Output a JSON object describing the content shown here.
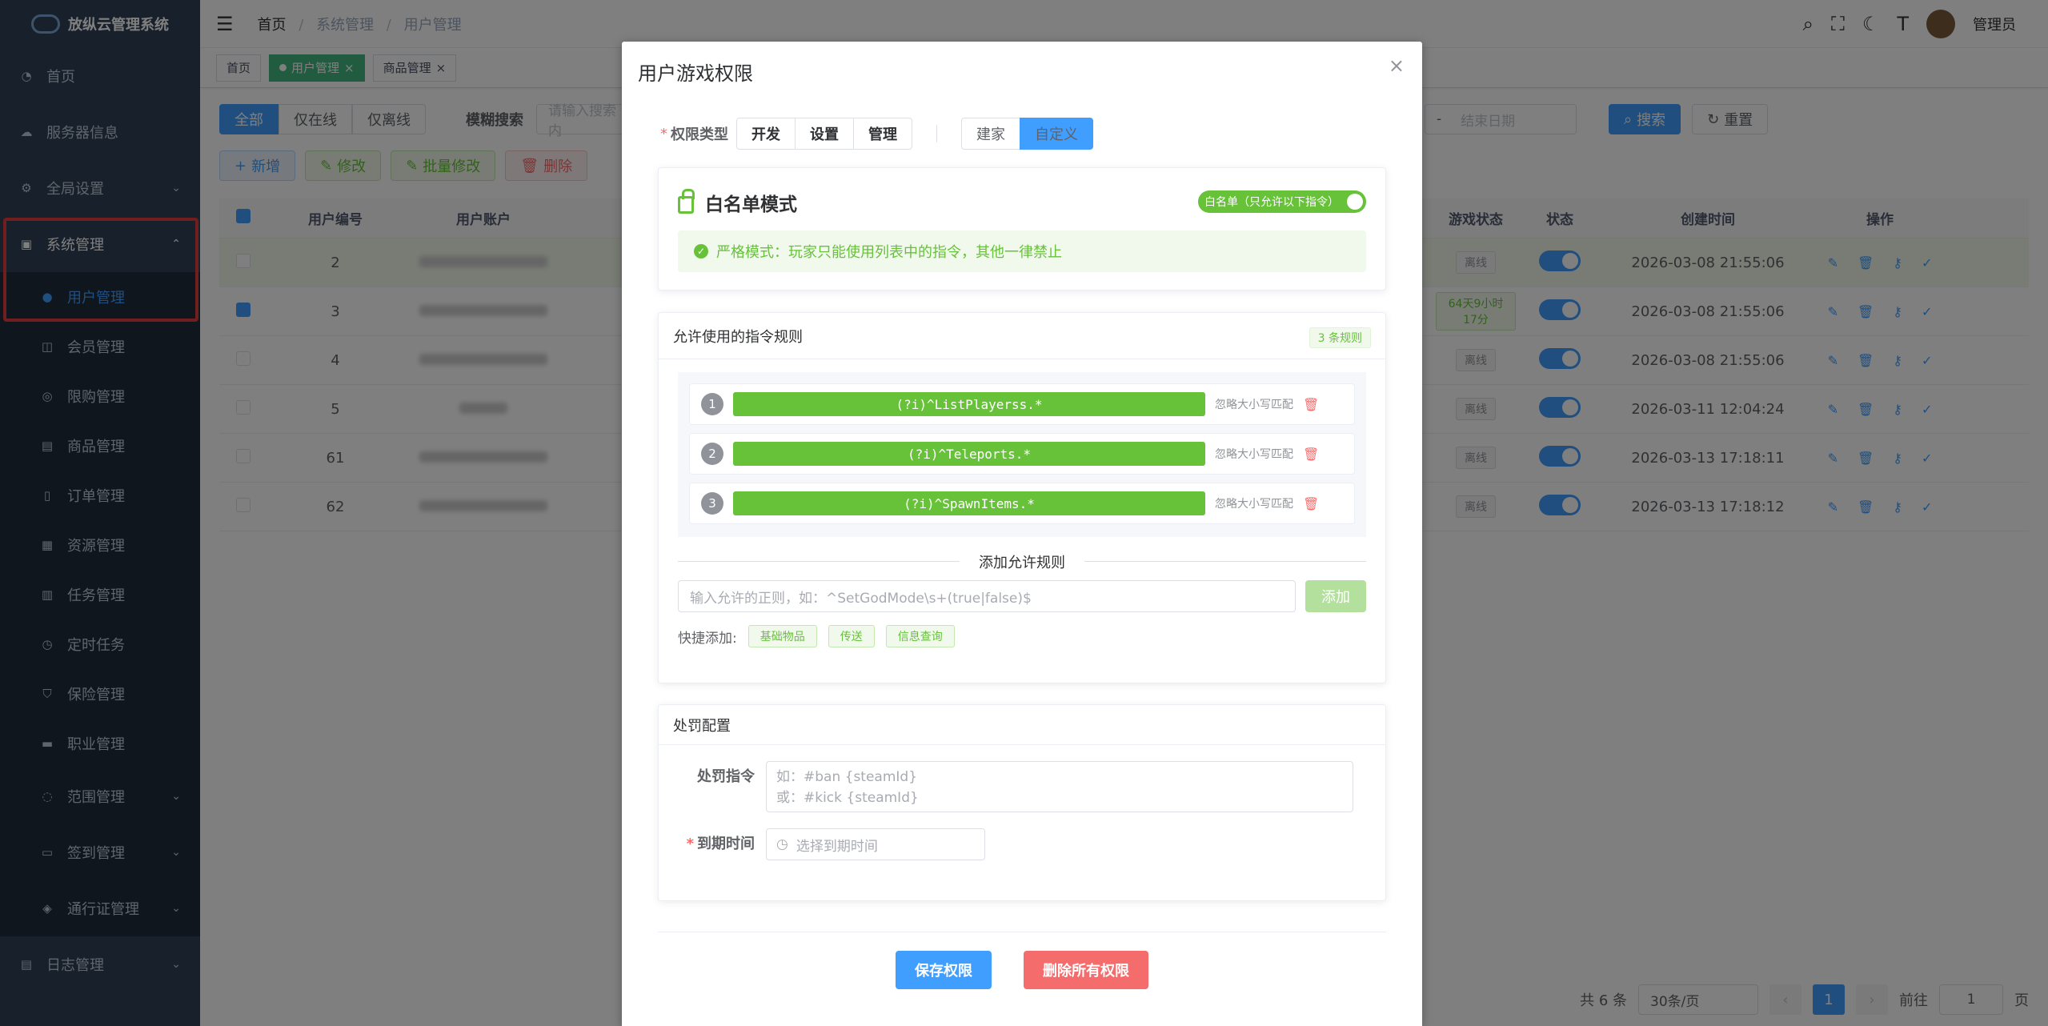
{
  "app": {
    "title": "放纵云管理系统"
  },
  "sidebar": {
    "items": [
      {
        "label": "首页",
        "icon": "dashboard-icon"
      },
      {
        "label": "服务器信息",
        "icon": "cloud-icon"
      },
      {
        "label": "全局设置",
        "icon": "gear-icon"
      },
      {
        "label": "系统管理",
        "icon": "monitor-icon"
      }
    ],
    "system_children": [
      {
        "label": "用户管理",
        "icon": "user-icon"
      },
      {
        "label": "会员管理",
        "icon": "vip-icon"
      },
      {
        "label": "限购管理",
        "icon": "limit-icon"
      },
      {
        "label": "商品管理",
        "icon": "cart-icon"
      },
      {
        "label": "订单管理",
        "icon": "order-icon"
      },
      {
        "label": "资源管理",
        "icon": "resource-icon"
      },
      {
        "label": "任务管理",
        "icon": "task-icon"
      },
      {
        "label": "定时任务",
        "icon": "clock-icon"
      },
      {
        "label": "保险管理",
        "icon": "shield-icon"
      },
      {
        "label": "职业管理",
        "icon": "briefcase-icon"
      },
      {
        "label": "范围管理",
        "icon": "range-icon"
      },
      {
        "label": "签到管理",
        "icon": "calendar-icon"
      },
      {
        "label": "通行证管理",
        "icon": "pass-icon"
      }
    ],
    "log": {
      "label": "日志管理",
      "icon": "log-icon"
    }
  },
  "header": {
    "breadcrumb": [
      "首页",
      "系统管理",
      "用户管理"
    ],
    "user": "管理员"
  },
  "tags": [
    "首页",
    "用户管理",
    "商品管理"
  ],
  "filters": {
    "online": [
      "全部",
      "仅在线",
      "仅离线"
    ],
    "fuzzy_label": "模糊搜索",
    "search_placeholder": "请输入搜索内",
    "date_sep": "-",
    "end_date": "结束日期",
    "search_btn": "搜索",
    "reset_btn": "重置"
  },
  "toolbar": {
    "add": "新增",
    "edit": "修改",
    "batch_edit": "批量修改",
    "delete": "删除"
  },
  "table": {
    "headers": {
      "id": "用户编号",
      "account": "用户账户",
      "game_status": "游戏状态",
      "status": "状态",
      "created": "创建时间",
      "ops": "操作"
    },
    "rows": [
      {
        "id": "2",
        "game": "离线",
        "created": "2026-03-08 21:55:06"
      },
      {
        "id": "3",
        "game": "64天9小时17分",
        "created": "2026-03-08 21:55:06"
      },
      {
        "id": "4",
        "game": "离线",
        "created": "2026-03-08 21:55:06"
      },
      {
        "id": "5",
        "game": "离线",
        "created": "2026-03-11 12:04:24"
      },
      {
        "id": "61",
        "game": "离线",
        "created": "2026-03-13 17:18:11"
      },
      {
        "id": "62",
        "game": "离线",
        "created": "2026-03-13 17:18:12"
      }
    ]
  },
  "pagination": {
    "total": "共 6 条",
    "page_size": "30条/页",
    "current": "1",
    "goto": "前往",
    "goto_value": "1",
    "page_unit": "页"
  },
  "dialog": {
    "title": "用户游戏权限",
    "perm_label": "权限类型",
    "types": [
      "开发",
      "设置",
      "管理"
    ],
    "types2": [
      "建家",
      "自定义"
    ],
    "whitelist": {
      "title": "白名单模式",
      "switch": "白名单（只允许以下指令）",
      "alert": "严格模式：玩家只能使用列表中的指令，其他一律禁止"
    },
    "rules": {
      "title": "允许使用的指令规则",
      "count": "3 条规则",
      "items": [
        {
          "num": "1",
          "pattern": "(?i)^ListPlayerss.*",
          "opt": "忽略大小写匹配"
        },
        {
          "num": "2",
          "pattern": "(?i)^Teleports.*",
          "opt": "忽略大小写匹配"
        },
        {
          "num": "3",
          "pattern": "(?i)^SpawnItems.*",
          "opt": "忽略大小写匹配"
        }
      ],
      "add_title": "添加允许规则",
      "add_placeholder": "输入允许的正则，如：^SetGodMode\\s+(true|false)$",
      "add_btn": "添加",
      "quick_label": "快捷添加:",
      "quick": [
        "基础物品",
        "传送",
        "信息查询"
      ]
    },
    "punish": {
      "title": "处罚配置",
      "cmd_label": "处罚指令",
      "cmd_placeholder": "如：#ban {steamId}\n或：#kick {steamId}",
      "expire_label": "到期时间",
      "expire_placeholder": "选择到期时间"
    },
    "save": "保存权限",
    "delete_all": "删除所有权限"
  }
}
